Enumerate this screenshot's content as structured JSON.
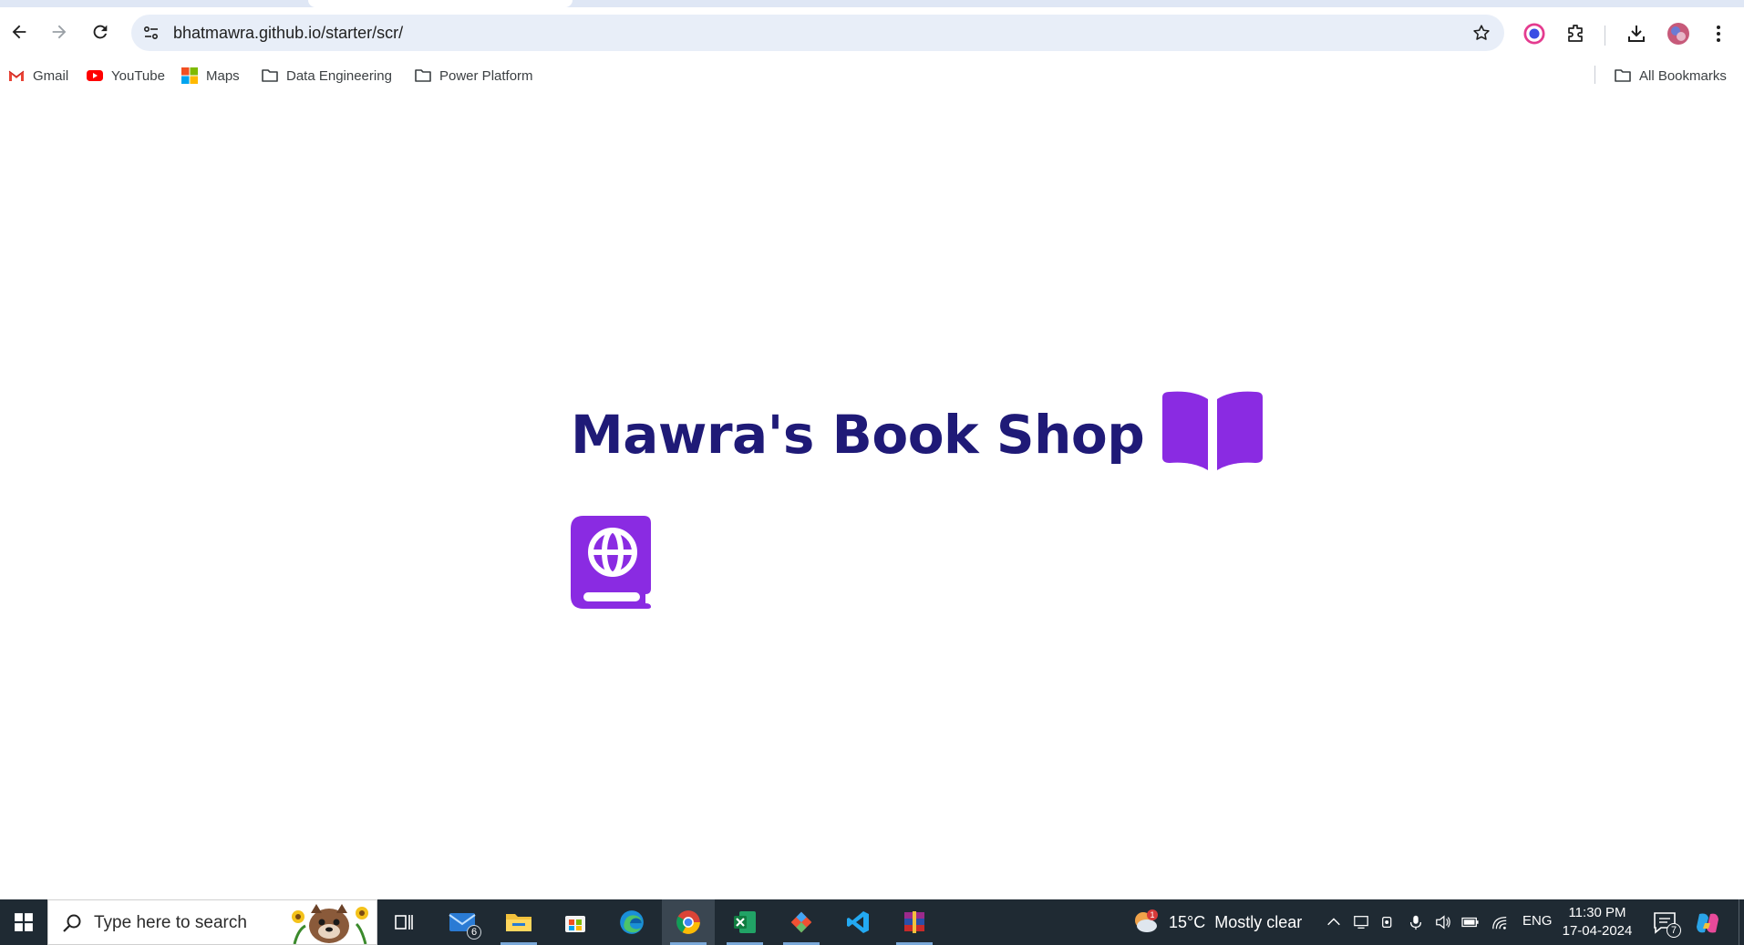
{
  "browser": {
    "url": "bhatmawra.github.io/starter/scr/",
    "bookmarks": [
      {
        "label": "Gmail",
        "icon": "gmail-icon"
      },
      {
        "label": "YouTube",
        "icon": "youtube-icon"
      },
      {
        "label": "Maps",
        "icon": "maps-icon"
      },
      {
        "label": "Data Engineering",
        "icon": "folder-icon"
      },
      {
        "label": "Power Platform",
        "icon": "folder-icon"
      }
    ],
    "all_bookmarks_label": "All Bookmarks"
  },
  "page": {
    "title": "Mawra's Book Shop",
    "title_color": "#1f1a77",
    "icon_color": "#8a2be2",
    "title_icon": "book-open-icon",
    "secondary_icon": "book-atlas-icon"
  },
  "taskbar": {
    "search_placeholder": "Type here to search",
    "apps": [
      {
        "name": "task-view",
        "icon": "task-view-icon"
      },
      {
        "name": "mail",
        "icon": "mail-icon",
        "badge": "6"
      },
      {
        "name": "file-explorer",
        "icon": "folder-icon"
      },
      {
        "name": "microsoft-store",
        "icon": "store-icon"
      },
      {
        "name": "edge",
        "icon": "edge-icon"
      },
      {
        "name": "chrome",
        "icon": "chrome-icon",
        "active": true
      },
      {
        "name": "excel",
        "icon": "excel-icon"
      },
      {
        "name": "git",
        "icon": "git-icon"
      },
      {
        "name": "vscode",
        "icon": "vscode-icon"
      },
      {
        "name": "winrar",
        "icon": "winrar-icon"
      }
    ],
    "weather": {
      "temp": "15°C",
      "condition": "Mostly clear",
      "alert_count": "1"
    },
    "language": "ENG",
    "time": "11:30 PM",
    "date": "17-04-2024",
    "notification_count": "7"
  }
}
